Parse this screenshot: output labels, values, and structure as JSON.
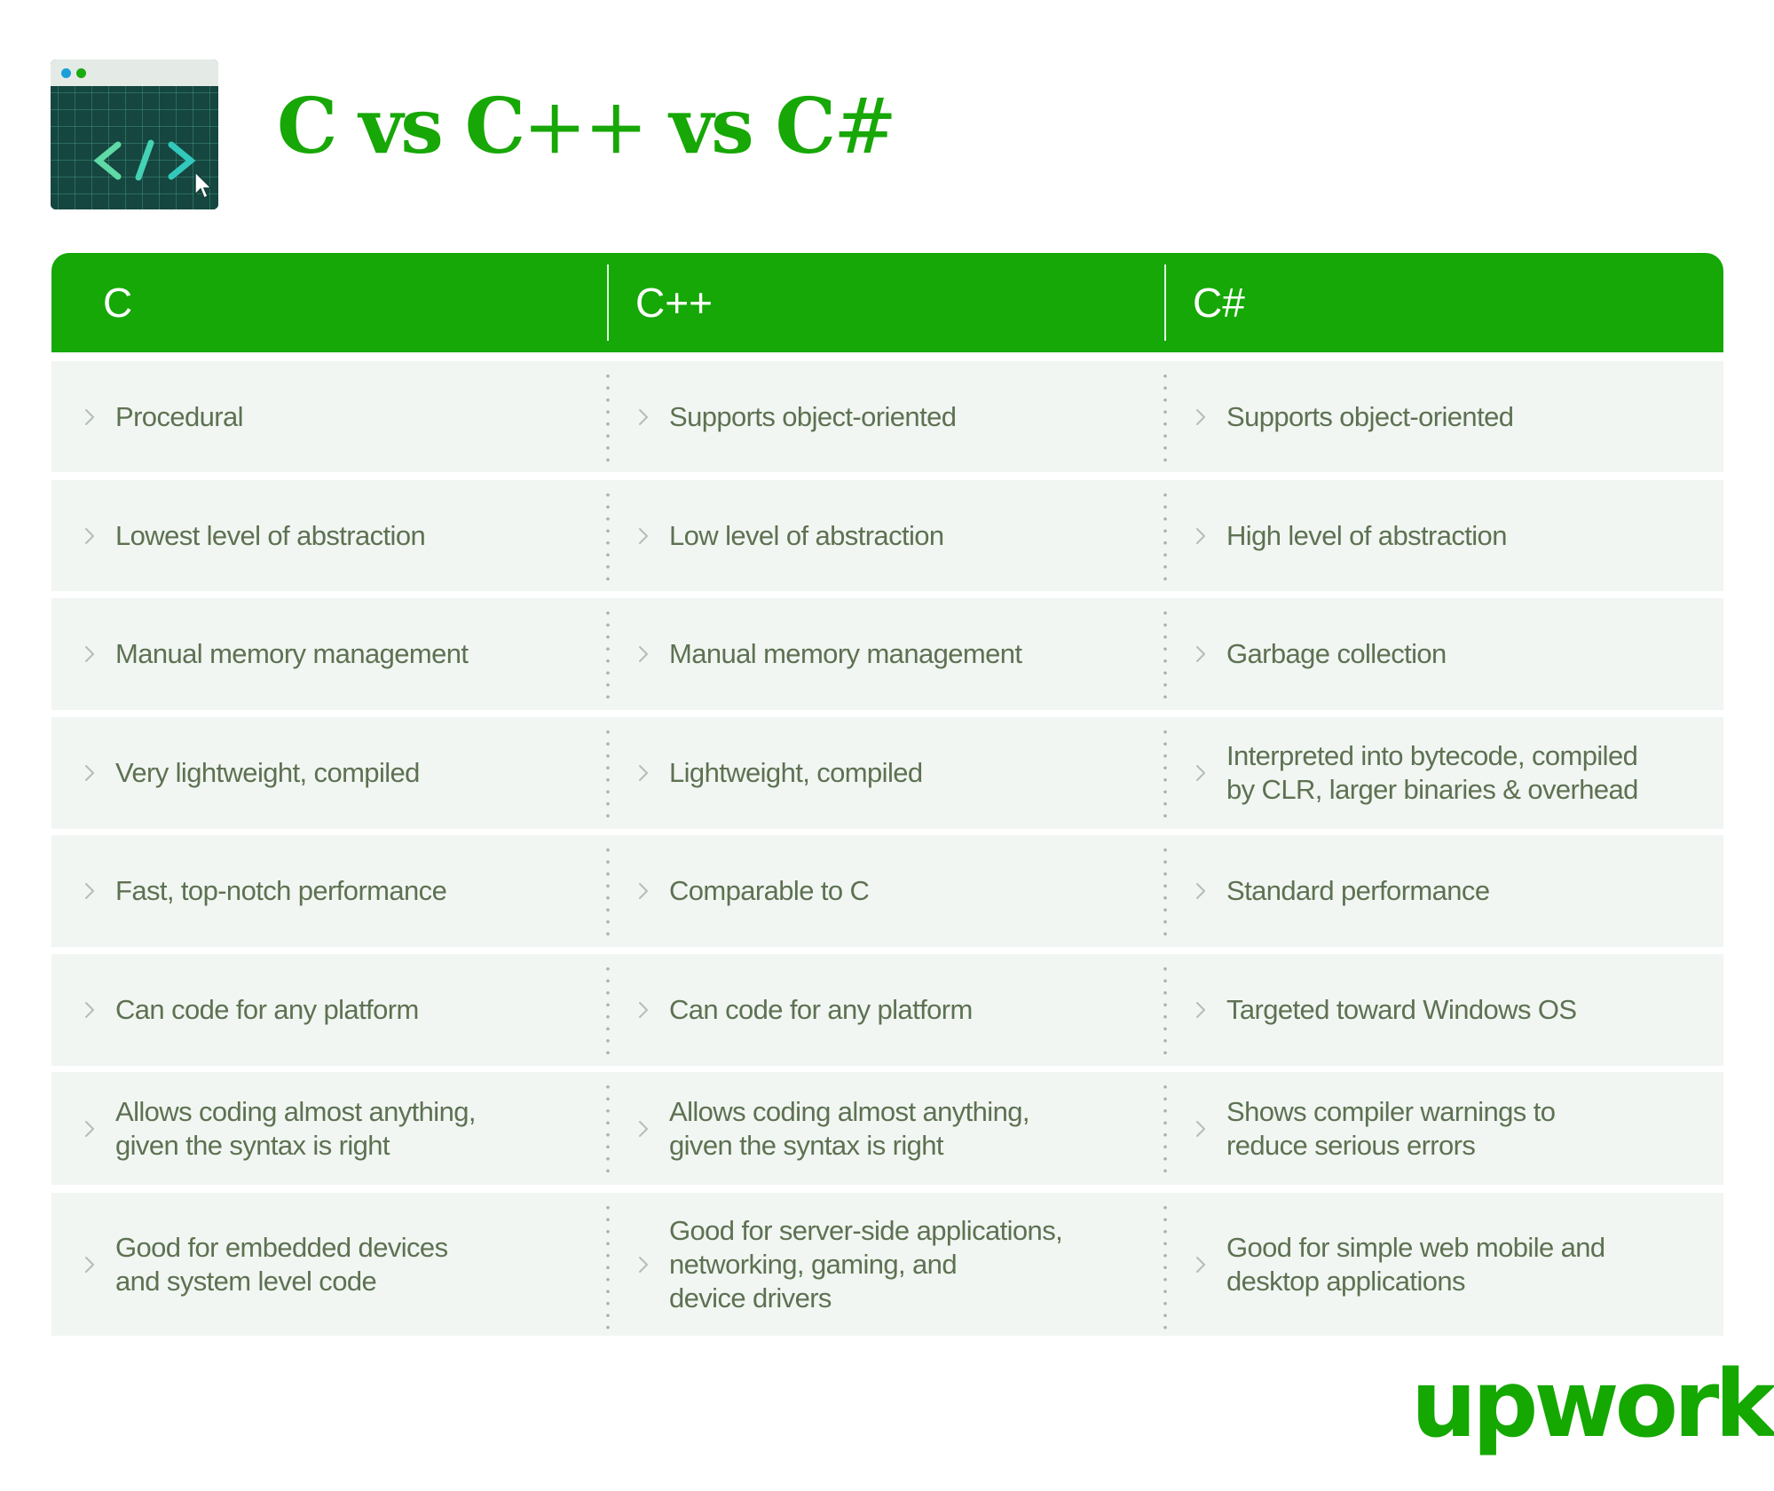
{
  "header": {
    "icon": "code-window-icon",
    "title_parts": [
      "C vs C",
      "++",
      " vs C",
      "#"
    ]
  },
  "table": {
    "columns": [
      "C",
      "C++",
      "C#"
    ],
    "rows": [
      [
        "Procedural",
        "Supports object-oriented",
        "Supports object-oriented"
      ],
      [
        "Lowest level of abstraction",
        "Low level of abstraction",
        "High level of abstraction"
      ],
      [
        "Manual memory management",
        "Manual memory management",
        "Garbage collection"
      ],
      [
        "Very lightweight, compiled",
        "Lightweight, compiled",
        "Interpreted into bytecode, compiled\nby CLR, larger binaries & overhead"
      ],
      [
        "Fast, top-notch performance",
        "Comparable to C",
        "Standard performance"
      ],
      [
        "Can code for any platform",
        "Can code for any platform",
        "Targeted toward Windows OS"
      ],
      [
        "Allows coding almost anything,\ngiven the syntax is right",
        "Allows coding almost anything,\ngiven the syntax is right",
        "Shows compiler warnings to\nreduce serious errors"
      ],
      [
        "Good for embedded devices\nand system level code",
        "Good for server-side applications,\nnetworking, gaming, and\ndevice drivers",
        "Good for simple web mobile and\ndesktop applications"
      ]
    ],
    "bullet_icon": "chevron-right-icon"
  },
  "footer": {
    "brand": "upwork"
  },
  "colors": {
    "brand_green": "#14a800",
    "title_green": "#17a706",
    "row_bg": "#f1f6f2",
    "body_text": "#5e7152",
    "icon_bg": "#15463f"
  }
}
